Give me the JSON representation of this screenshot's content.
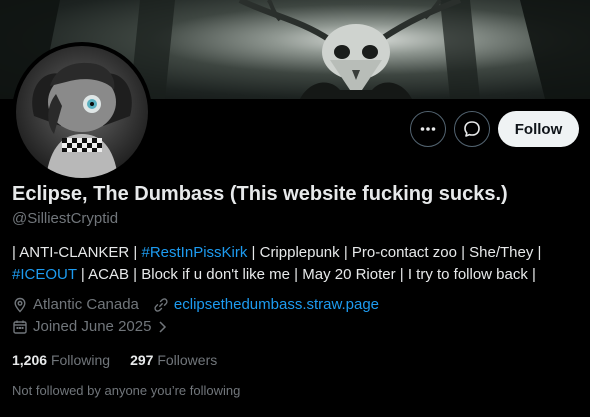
{
  "profile": {
    "display_name": "Eclipse, The Dumbass (This website fucking sucks.)",
    "handle": "@SilliestCryptid",
    "bio": {
      "line1": {
        "p1": "| ANTI-CLANKER | ",
        "tag1": "#RestInPissKirk",
        "p2": " | Cripplepunk | Pro-contact zoo | She/They |"
      },
      "line2": {
        "tag2": "#ICEOUT",
        "p3": " | ACAB | Block if u don't like me | May 20 Rioter | I try to follow back |"
      }
    },
    "location": "Atlantic Canada",
    "website": "eclipsethedumbass.straw.page",
    "joined": "Joined June 2025",
    "stats": {
      "following_count": "1,206",
      "following_label": "Following",
      "followers_count": "297",
      "followers_label": "Followers"
    },
    "not_followed_text": "Not followed by anyone you’re following"
  },
  "actions": {
    "follow_label": "Follow",
    "more_icon": "more-icon",
    "message_icon": "message-icon"
  },
  "colors": {
    "accent_link": "#1d9bf0",
    "muted_text": "#71767b",
    "primary_text": "#e7e9ea",
    "follow_button_bg": "#eff3f4"
  }
}
